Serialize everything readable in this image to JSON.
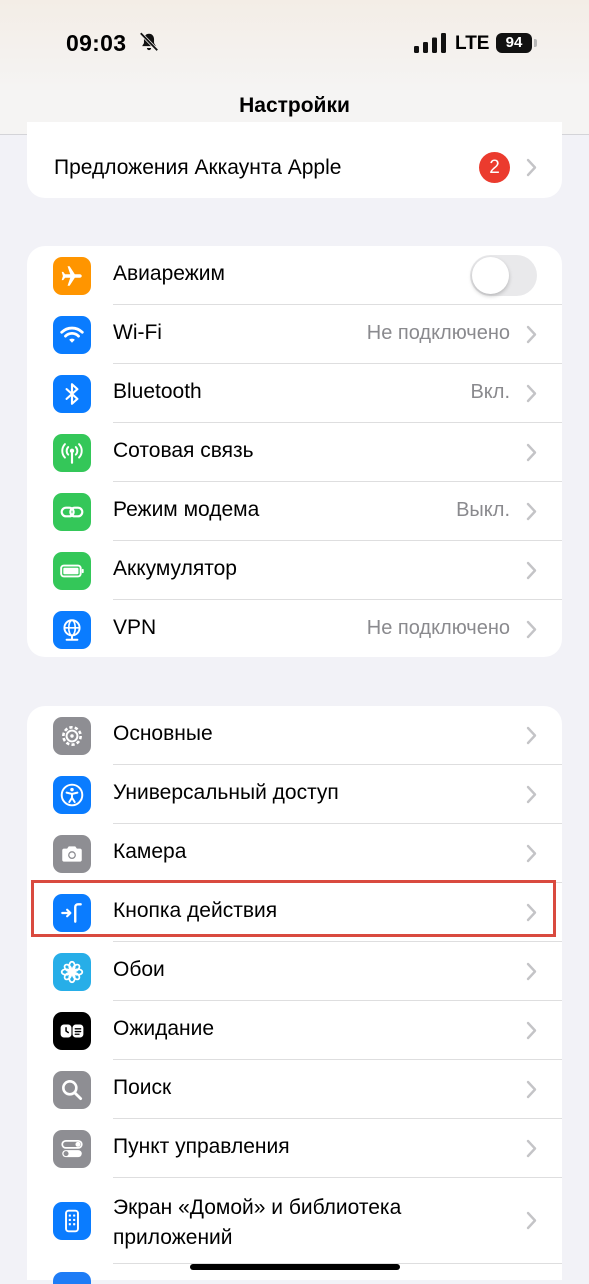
{
  "status_bar": {
    "time": "09:03",
    "network": "LTE",
    "battery": "94"
  },
  "nav": {
    "title": "Настройки"
  },
  "account_suggestions": {
    "label": "Предложения Аккаунта Apple",
    "badge": "2"
  },
  "network_group": [
    {
      "label": "Авиарежим",
      "value": "",
      "icon": "airplane-icon",
      "color": "#ff9500",
      "toggle": false
    },
    {
      "label": "Wi-Fi",
      "value": "Не подключено",
      "icon": "wifi-icon",
      "color": "#0a7cff"
    },
    {
      "label": "Bluetooth",
      "value": "Вкл.",
      "icon": "bluetooth-icon",
      "color": "#0a7cff"
    },
    {
      "label": "Сотовая связь",
      "value": "",
      "icon": "antenna-icon",
      "color": "#34c759"
    },
    {
      "label": "Режим модема",
      "value": "Выкл.",
      "icon": "chain-link-icon",
      "color": "#34c759"
    },
    {
      "label": "Аккумулятор",
      "value": "",
      "icon": "battery-icon",
      "color": "#34c759"
    },
    {
      "label": "VPN",
      "value": "Не подключено",
      "icon": "globe-network-icon",
      "color": "#0a7cff"
    }
  ],
  "general_group": [
    {
      "label": "Основные",
      "icon": "gear-icon",
      "color": "#8e8e93"
    },
    {
      "label": "Универсальный доступ",
      "icon": "accessibility-icon",
      "color": "#0a7cff"
    },
    {
      "label": "Камера",
      "icon": "camera-icon",
      "color": "#8e8e93"
    },
    {
      "label": "Кнопка действия",
      "icon": "action-button-icon",
      "color": "#0a7cff",
      "highlighted": true
    },
    {
      "label": "Обои",
      "icon": "flower-icon",
      "color": "#27aee8"
    },
    {
      "label": "Ожидание",
      "icon": "standby-icon",
      "color": "#000000"
    },
    {
      "label": "Поиск",
      "icon": "search-icon",
      "color": "#8e8e93"
    },
    {
      "label": "Пункт управления",
      "icon": "toggles-icon",
      "color": "#8e8e93"
    },
    {
      "label": "Экран «Домой» и библиотека приложений",
      "icon": "home-screen-icon",
      "color": "#0a7cff"
    }
  ],
  "colors": {
    "badge": "#eb3b2e",
    "highlight_border": "#d94a3f",
    "background": "#f2f2f7"
  }
}
